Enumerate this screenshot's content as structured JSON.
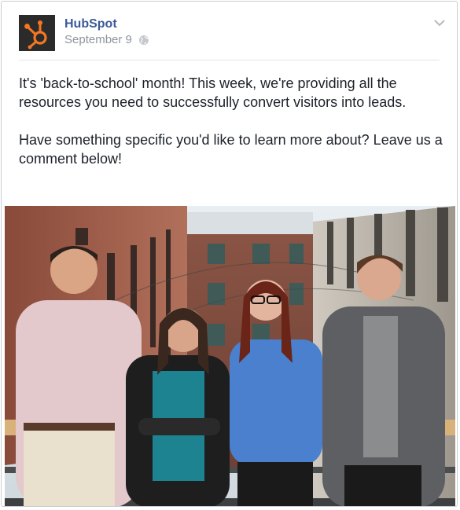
{
  "post": {
    "page_name": "HubSpot",
    "date": "September 9",
    "privacy_icon": "globe-icon",
    "menu_icon": "chevron-down-icon",
    "text": {
      "paragraph_1": "It's 'back-to-school' month! This week, we're providing all the resources you need to successfully convert visitors into leads.",
      "paragraph_2": "Have something specific you'd like to learn more about? Leave us a comment below!"
    },
    "colors": {
      "name_link": "#3b5998",
      "meta_text": "#90949c",
      "logo_accent": "#f57722"
    }
  }
}
